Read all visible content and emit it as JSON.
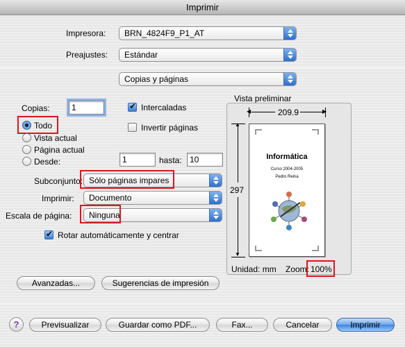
{
  "window": {
    "title": "Imprimir"
  },
  "printer": {
    "label": "Impresora:",
    "value": "BRN_4824F9_P1_AT"
  },
  "presets": {
    "label": "Preajustes:",
    "value": "Estándar"
  },
  "panel": {
    "value": "Copias y páginas"
  },
  "copies": {
    "label": "Copias:",
    "value": "1",
    "collate_label": "Intercaladas",
    "collate_checked": true,
    "reverse_label": "Invertir páginas",
    "reverse_checked": false
  },
  "pages": {
    "options": [
      "Todo",
      "Vista actual",
      "Página actual",
      "Desde:"
    ],
    "selected": "Todo",
    "from_value": "1",
    "to_label": "hasta:",
    "to_value": "10"
  },
  "subset": {
    "label": "Subconjunto:",
    "value": "Sólo páginas impares"
  },
  "print_what": {
    "label": "Imprimir:",
    "value": "Documento"
  },
  "page_scale": {
    "label": "Escala de página:",
    "value": "Ninguna"
  },
  "auto_rotate": {
    "label": "Rotar automáticamente y centrar",
    "checked": true
  },
  "preview": {
    "title": "Vista preliminar",
    "width": "209.9",
    "height": "297",
    "units_label": "Unidad: mm",
    "zoom_label": "Zoom:",
    "zoom_value": "100%",
    "doc_title": "Informática",
    "doc_line1": "Curso 2004-2005",
    "doc_line2": "Pedro Reina"
  },
  "actions": {
    "advanced": "Avanzadas...",
    "suggestions": "Sugerencias de impresión",
    "help": "?",
    "preview": "Previsualizar",
    "save_pdf": "Guardar como PDF...",
    "fax": "Fax...",
    "cancel": "Cancelar",
    "print": "Imprimir"
  },
  "colors": {
    "highlight": "#e0141b",
    "accent": "#3c86e0"
  }
}
